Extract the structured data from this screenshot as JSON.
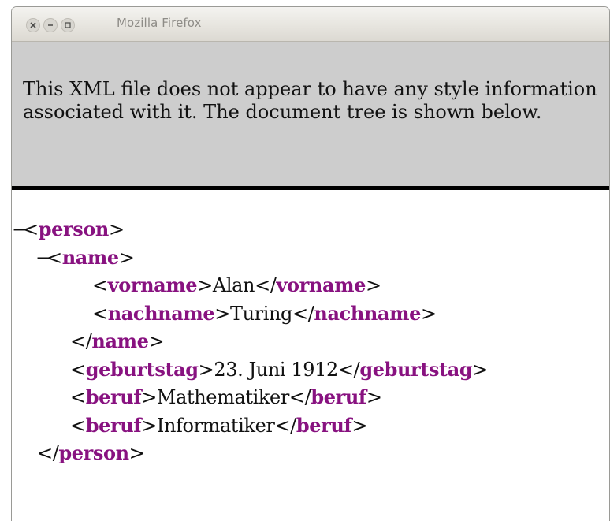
{
  "window": {
    "title": "Mozilla Firefox"
  },
  "notice": {
    "text": "This XML file does not appear to have any style information associated with it. The document tree is shown below."
  },
  "tree": {
    "collapse_symbol": "−",
    "person_tag": "person",
    "name_tag": "name",
    "vorname_tag": "vorname",
    "vorname_value": "Alan",
    "nachname_tag": "nachname",
    "nachname_value": "Turing",
    "geburtstag_tag": "geburtstag",
    "geburtstag_value": "23. Juni 1912",
    "beruf_tag": "beruf",
    "beruf_1_value": "Mathematiker",
    "beruf_2_value": "Informatiker"
  },
  "colors": {
    "tag_name": "#881280",
    "notice_bg": "#cdcdcd"
  },
  "icons": [
    "close-icon",
    "minimize-icon",
    "maximize-icon"
  ]
}
